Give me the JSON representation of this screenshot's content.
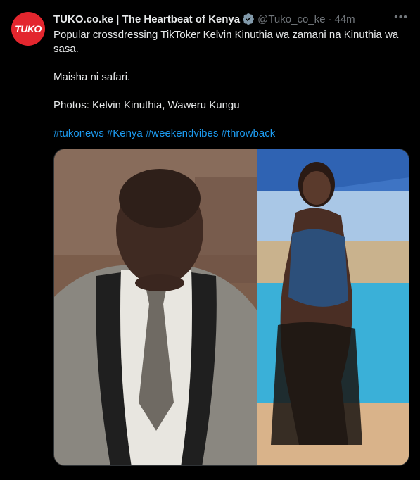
{
  "tweet": {
    "avatar_text": "TUKO",
    "display_name": "TUKO.co.ke | The Heartbeat of Kenya",
    "handle": "@Tuko_co_ke",
    "separator": "·",
    "time": "44m",
    "more_label": "•••",
    "text_line1": "Popular crossdressing TikToker Kelvin Kinuthia wa zamani na Kinuthia wa sasa.",
    "text_line2": "Maisha ni safari.",
    "text_line3": "Photos: Kelvin Kinuthia, Waweru Kungu",
    "hashtags": [
      "#tukonews",
      "#Kenya",
      "#weekendvibes",
      "#throwback"
    ]
  },
  "colors": {
    "background": "#000000",
    "text": "#e7e9ea",
    "muted": "#71767b",
    "link": "#1d9bf0",
    "brand": "#e3262e",
    "verified": "#829aab"
  },
  "icons": {
    "verified": "verified-badge-icon",
    "more": "more-options-icon"
  }
}
